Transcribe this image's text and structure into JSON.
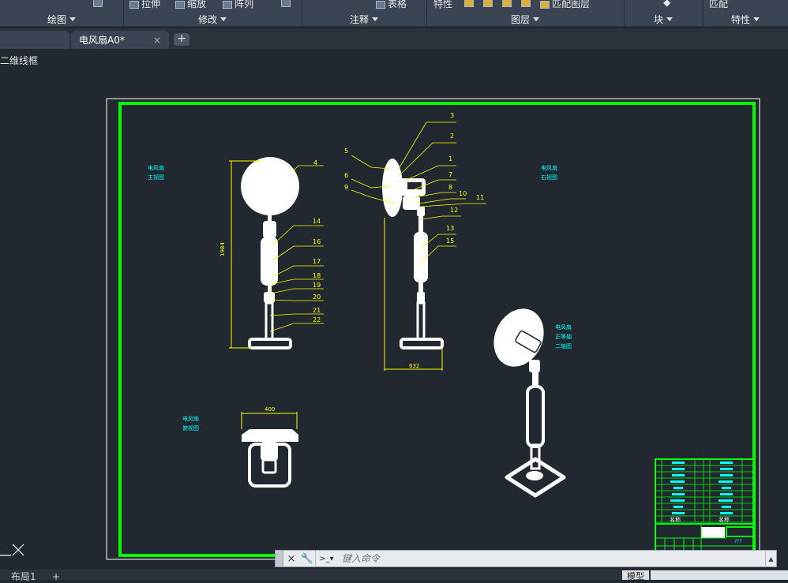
{
  "ribbon": {
    "row1": {
      "stretch": "拉伸",
      "scale": "缩放",
      "array": "阵列",
      "table": "表格",
      "properties": "特性",
      "match_layer": "匹配图层",
      "match": "匹配"
    },
    "panels": [
      "绘图",
      "修改",
      "注释",
      "图层",
      "块",
      "特性"
    ]
  },
  "tabs": {
    "active": "电风扇A0*",
    "close_glyph": "×",
    "add_glyph": "+"
  },
  "viewport": {
    "label": "二维线框"
  },
  "drawing": {
    "view_labels": {
      "main": [
        "电风扇",
        "主视图"
      ],
      "right": [
        "电风扇",
        "右视图"
      ],
      "top": [
        "电风扇",
        "俯视图"
      ],
      "iso": [
        "电风扇",
        "正等轴",
        "二轴图"
      ]
    },
    "dims": {
      "height": "1984",
      "width_right": "632",
      "width_top": "400"
    },
    "callouts_main": [
      "4",
      "14",
      "16",
      "17",
      "18",
      "19",
      "20",
      "21",
      "22"
    ],
    "callouts_right": [
      "5",
      "6",
      "9",
      "3",
      "2",
      "1",
      "7",
      "8",
      "10",
      "11",
      "12",
      "13",
      "15"
    ],
    "title_block": {
      "header_left": "名称",
      "header_right": "名称",
      "total": "???"
    },
    "colors": {
      "frame": "#00ff00",
      "callout": "#ffff00",
      "label": "#00ffff",
      "geometry": "#ffffff",
      "sheet": "#ffffff"
    }
  },
  "command": {
    "placeholder": "键入命令",
    "close_glyph": "×",
    "tool_glyph": "🔧",
    "prompt_glyph": ">_▾"
  },
  "status": {
    "layout_tab": "布局1",
    "add_glyph": "+",
    "model": "模型"
  }
}
